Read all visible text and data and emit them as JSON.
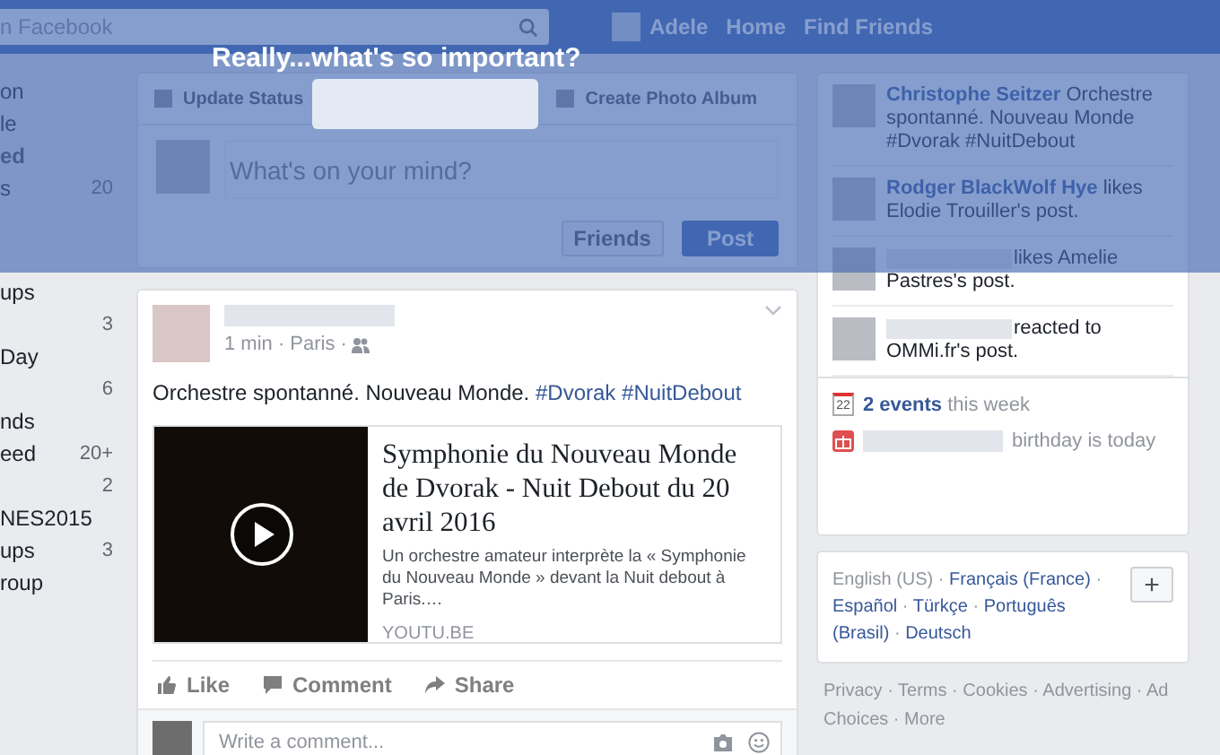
{
  "header": {
    "search_placeholder": "n Facebook",
    "profile_name": "Adele",
    "nav": [
      "Home",
      "Find Friends"
    ]
  },
  "overlay": {
    "message": "Really...what's so important?"
  },
  "sidebar": {
    "items": [
      {
        "label": "on",
        "kind": "item"
      },
      {
        "label": "le",
        "kind": "item"
      },
      {
        "label": "ed",
        "kind": "section"
      },
      {
        "label": "s",
        "count": "20",
        "kind": "item"
      },
      {
        "label": "ups",
        "kind": "item"
      },
      {
        "count": "3",
        "kind": "item"
      },
      {
        "label": "Day",
        "kind": "item"
      },
      {
        "count": "6",
        "kind": "item"
      },
      {
        "label": "nds",
        "kind": "item"
      },
      {
        "label": "eed",
        "count": "20+",
        "kind": "item"
      },
      {
        "count": "2",
        "kind": "item"
      },
      {
        "label": "NES2015",
        "kind": "item"
      },
      {
        "label": "ups",
        "count": "3",
        "kind": "item"
      },
      {
        "label": "roup",
        "kind": "item"
      }
    ]
  },
  "composer": {
    "tabs": [
      "Update Status",
      "Create Photo Album"
    ],
    "placeholder": "What's on your mind?",
    "audience": "Friends",
    "post_button": "Post"
  },
  "post": {
    "meta": "1 min · Paris ·",
    "text": "Orchestre spontanné. Nouveau Monde.",
    "hashtags": [
      "#Dvorak",
      "#NuitDebout"
    ],
    "link": {
      "title": "Symphonie du Nouveau Monde de Dvorak - Nuit Debout du 20 avril 2016",
      "description": "Un orchestre amateur interprète la « Symphonie du Nouveau Monde » devant la Nuit debout à Paris.…",
      "domain": "YOUTU.BE"
    },
    "actions": [
      {
        "label": "Like",
        "kind": "like"
      },
      {
        "label": "Comment",
        "kind": "comment"
      },
      {
        "label": "Share",
        "kind": "share"
      }
    ],
    "comment_placeholder": "Write a comment..."
  },
  "ticker": [
    {
      "actor": "Christophe Seitzer",
      "text": "Orchestre spontanné. Nouveau Monde #Dvorak #NuitDebout"
    },
    {
      "actor": "Rodger BlackWolf Hye",
      "text": "likes Elodie Trouiller's post."
    },
    {
      "text": "likes Amelie Pastres's post."
    },
    {
      "text": "reacted to OMMi.fr's post."
    }
  ],
  "events": {
    "calendar_day": "22",
    "count_link": "2 events",
    "suffix": "this week",
    "birthday": "birthday is today"
  },
  "languages": {
    "separator": "·",
    "items": [
      {
        "label": "English (US)",
        "selected": true
      },
      {
        "label": "Français (France)",
        "selected": false
      },
      {
        "label": "Español",
        "selected": false
      },
      {
        "label": "Türkçe",
        "selected": false
      },
      {
        "label": "Português (Brasil)",
        "selected": false
      },
      {
        "label": "Deutsch",
        "selected": false
      }
    ],
    "add_button": "+"
  },
  "footer": {
    "separator": "·",
    "links": [
      "Privacy",
      "Terms",
      "Cookies",
      "Advertising",
      "Ad Choices",
      "More"
    ]
  }
}
